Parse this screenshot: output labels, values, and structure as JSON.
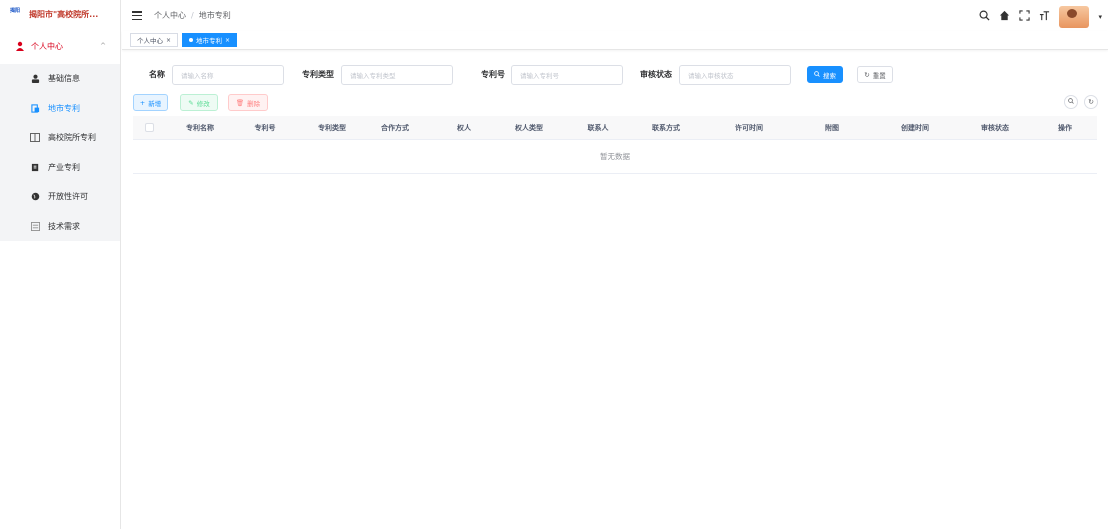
{
  "app": {
    "title": "揭阳市\"高校院所...",
    "logo_text": "揭阳"
  },
  "sidebar": {
    "parent": {
      "label": "个人中心",
      "icon": "user-icon"
    },
    "items": [
      {
        "label": "基础信息",
        "icon": "person-icon",
        "active": false
      },
      {
        "label": "地市专利",
        "icon": "document-icon",
        "active": true
      },
      {
        "label": "高校院所专利",
        "icon": "book-icon",
        "active": false
      },
      {
        "label": "产业专利",
        "icon": "factory-icon",
        "active": false
      },
      {
        "label": "开放性许可",
        "icon": "globe-icon",
        "active": false
      },
      {
        "label": "技术需求",
        "icon": "list-icon",
        "active": false
      }
    ]
  },
  "breadcrumb": {
    "first": "个人中心",
    "separator": "/",
    "second": "地市专利"
  },
  "tags": [
    {
      "label": "个人中心",
      "active": false
    },
    {
      "label": "地市专利",
      "active": true
    }
  ],
  "search": {
    "name_label": "名称",
    "name_placeholder": "请输入名称",
    "type_label": "专利类型",
    "type_placeholder": "请输入专利类型",
    "number_label": "专利号",
    "number_placeholder": "请输入专利号",
    "status_label": "审核状态",
    "status_placeholder": "请输入审核状态",
    "search_btn": "搜索",
    "reset_btn": "重置"
  },
  "toolbar": {
    "add": "新增",
    "edit": "修改",
    "delete": "删除"
  },
  "table": {
    "columns": [
      "专利名称",
      "专利号",
      "专利类型",
      "合作方式",
      "权人",
      "权人类型",
      "联系人",
      "联系方式",
      "许可时间",
      "附图",
      "创建时间",
      "审核状态",
      "操作"
    ],
    "empty_text": "暂无数据"
  },
  "colors": {
    "primary": "#1890ff",
    "brand_red": "#d9001b"
  }
}
